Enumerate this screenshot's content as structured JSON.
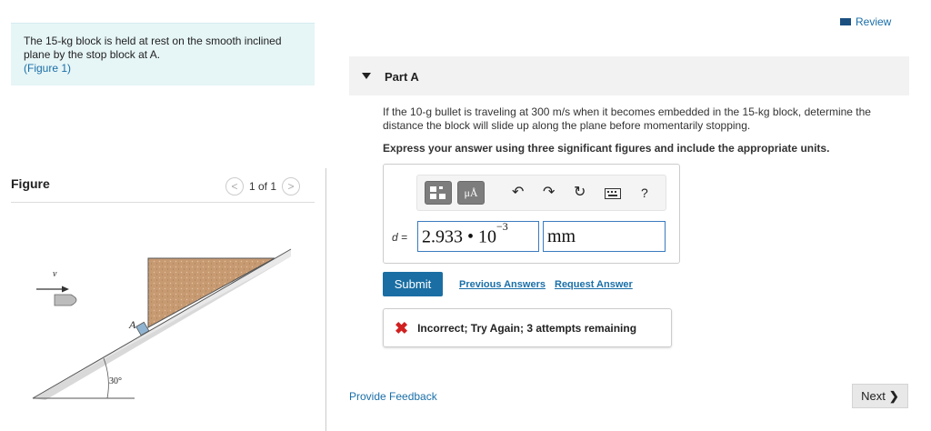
{
  "problem": {
    "line1": "The 15-kg block is held at rest on the smooth inclined",
    "line2": "plane by the stop block at A.",
    "figure_link": "(Figure 1)"
  },
  "figure_panel": {
    "title": "Figure",
    "page_indicator": "1 of 1",
    "labels": {
      "velocity": "v",
      "stop": "A",
      "angle": "30°"
    }
  },
  "header": {
    "review_label": "Review"
  },
  "part": {
    "label": "Part A",
    "question": "If the 10-g bullet is traveling at 300 m/s when it becomes embedded in the 15-kg block, determine the distance the block will slide up along the plane before momentarily stopping.",
    "instruction": "Express your answer using three significant figures and include the appropriate units."
  },
  "toolbar": {
    "units_button": "μÅ",
    "help_button": "?"
  },
  "answer": {
    "variable": "d =",
    "mantissa": "2.933 • 10",
    "exponent": "−3",
    "unit": "mm"
  },
  "actions": {
    "submit": "Submit",
    "previous_answers": "Previous Answers",
    "request_answer": "Request Answer"
  },
  "feedback": {
    "icon": "✖",
    "message": "Incorrect; Try Again; 3 attempts remaining"
  },
  "footer": {
    "provide_feedback": "Provide Feedback",
    "next": "Next"
  },
  "colors": {
    "link": "#1a6fa8",
    "submit": "#1a6ea3",
    "error": "#d12020",
    "problem_bg": "#e6f5f6"
  }
}
